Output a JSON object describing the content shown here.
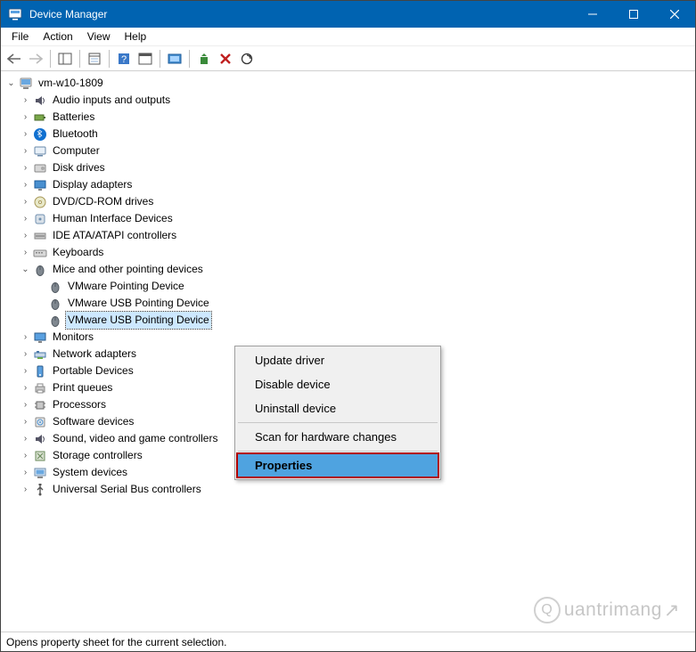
{
  "window": {
    "title": "Device Manager"
  },
  "menubar": [
    "File",
    "Action",
    "View",
    "Help"
  ],
  "toolbar_tooltips": {
    "back": "Back",
    "forward": "Forward",
    "show_hide_tree": "Show/Hide Console Tree",
    "properties": "Properties",
    "help": "Help",
    "action_window": "Action",
    "show_hidden": "Show hidden devices",
    "update": "Update driver",
    "uninstall": "Uninstall device",
    "scan": "Scan for hardware changes"
  },
  "root": {
    "label": "vm-w10-1809"
  },
  "categories": [
    {
      "label": "Audio inputs and outputs",
      "expanded": false,
      "icon": "audio"
    },
    {
      "label": "Batteries",
      "expanded": false,
      "icon": "battery"
    },
    {
      "label": "Bluetooth",
      "expanded": false,
      "icon": "bluetooth"
    },
    {
      "label": "Computer",
      "expanded": false,
      "icon": "computer"
    },
    {
      "label": "Disk drives",
      "expanded": false,
      "icon": "disk"
    },
    {
      "label": "Display adapters",
      "expanded": false,
      "icon": "display"
    },
    {
      "label": "DVD/CD-ROM drives",
      "expanded": false,
      "icon": "cd"
    },
    {
      "label": "Human Interface Devices",
      "expanded": false,
      "icon": "hid"
    },
    {
      "label": "IDE ATA/ATAPI controllers",
      "expanded": false,
      "icon": "ide"
    },
    {
      "label": "Keyboards",
      "expanded": false,
      "icon": "keyboard"
    },
    {
      "label": "Mice and other pointing devices",
      "expanded": true,
      "icon": "mouse",
      "children": [
        {
          "label": "VMware Pointing Device",
          "icon": "mouse",
          "selected": false
        },
        {
          "label": "VMware USB Pointing Device",
          "icon": "mouse",
          "selected": false
        },
        {
          "label": "VMware USB Pointing Device",
          "icon": "mouse",
          "selected": true
        }
      ]
    },
    {
      "label": "Monitors",
      "expanded": false,
      "icon": "monitor"
    },
    {
      "label": "Network adapters",
      "expanded": false,
      "icon": "network"
    },
    {
      "label": "Portable Devices",
      "expanded": false,
      "icon": "portable"
    },
    {
      "label": "Print queues",
      "expanded": false,
      "icon": "printer"
    },
    {
      "label": "Processors",
      "expanded": false,
      "icon": "cpu"
    },
    {
      "label": "Software devices",
      "expanded": false,
      "icon": "software"
    },
    {
      "label": "Sound, video and game controllers",
      "expanded": false,
      "icon": "audio"
    },
    {
      "label": "Storage controllers",
      "expanded": false,
      "icon": "storage"
    },
    {
      "label": "System devices",
      "expanded": false,
      "icon": "system"
    },
    {
      "label": "Universal Serial Bus controllers",
      "expanded": false,
      "icon": "usb"
    }
  ],
  "context_menu": [
    {
      "label": "Update driver",
      "type": "item"
    },
    {
      "label": "Disable device",
      "type": "item"
    },
    {
      "label": "Uninstall device",
      "type": "item"
    },
    {
      "type": "sep"
    },
    {
      "label": "Scan for hardware changes",
      "type": "item"
    },
    {
      "type": "sep"
    },
    {
      "label": "Properties",
      "type": "item",
      "highlighted": true
    }
  ],
  "statusbar": "Opens property sheet for the current selection.",
  "watermark": "uantrimang"
}
